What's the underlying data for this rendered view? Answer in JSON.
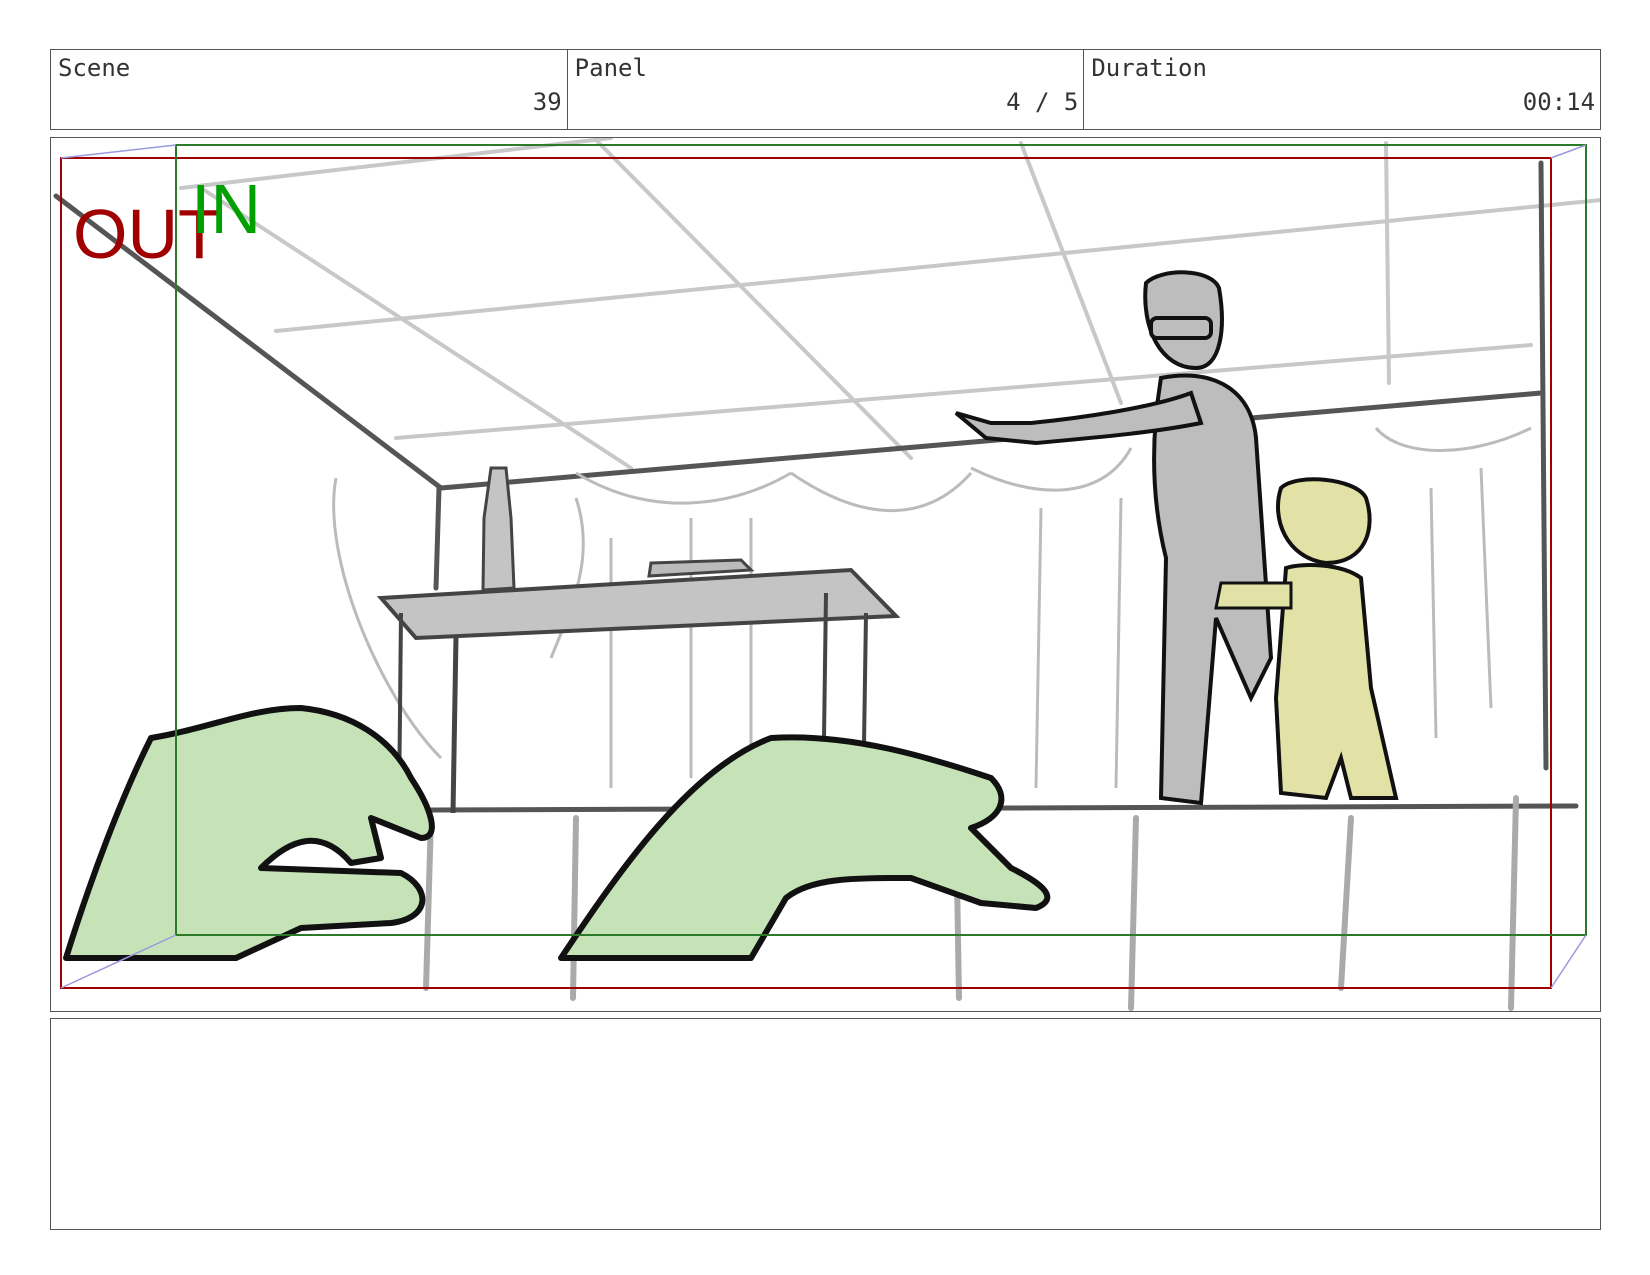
{
  "header": {
    "scene_label": "Scene",
    "scene_value": "39",
    "panel_label": "Panel",
    "panel_value": "4 / 5",
    "duration_label": "Duration",
    "duration_value": "00:14"
  },
  "frame_guides": {
    "out_label": "OUT",
    "in_label": "IN",
    "out_color": "#a00000",
    "in_color": "#00a000"
  },
  "colors": {
    "hands_fill": "#c6e3b8",
    "child_fill": "#e3e2a6",
    "adult_fill": "#bdbdbd",
    "ink": "#111111",
    "set_lines": "#c8c8c8",
    "structure_lines": "#555555"
  },
  "notes": {
    "text": ""
  }
}
